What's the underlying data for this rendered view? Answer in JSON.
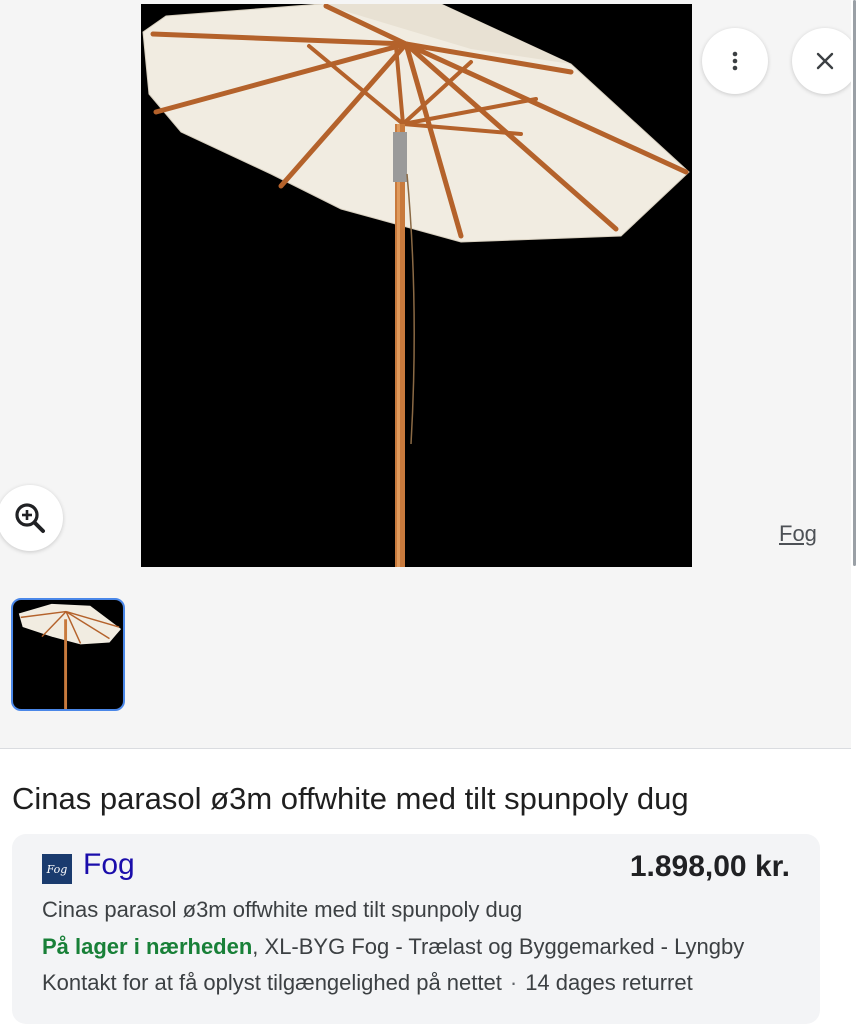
{
  "viewer": {
    "source_label": "Fog",
    "more_icon": "more-vert-icon",
    "close_icon": "close-icon",
    "zoom_icon": "zoom-in-icon"
  },
  "product": {
    "title": "Cinas parasol ø3m offwhite med tilt spunpoly dug"
  },
  "offer": {
    "merchant_logo_text": "Fog",
    "merchant_name": "Fog",
    "price": "1.898,00 kr.",
    "description": "Cinas parasol ø3m offwhite med tilt spunpoly dug",
    "stock_status": "På lager i nærheden",
    "store": ", XL-BYG Fog - Trælast og Byggemarked - Lyngby",
    "availability_note": "Kontakt for at få oplyst tilgængelighed på nettet",
    "separator": "·",
    "returns": "14 dages returret"
  },
  "colors": {
    "link": "#1a0dab",
    "in_stock": "#188038",
    "thumb_border": "#4a87e8"
  }
}
